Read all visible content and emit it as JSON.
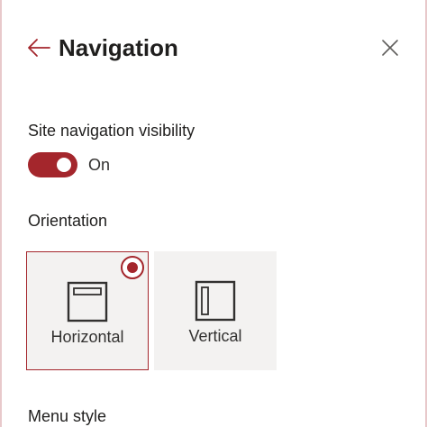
{
  "panel": {
    "title": "Navigation",
    "back_icon": "arrow-left-icon",
    "close_icon": "close-icon"
  },
  "visibility": {
    "label": "Site navigation visibility",
    "toggle_state": "On",
    "enabled": true
  },
  "orientation": {
    "label": "Orientation",
    "options": [
      {
        "label": "Horizontal",
        "selected": true,
        "icon": "horizontal-layout-icon"
      },
      {
        "label": "Vertical",
        "selected": false,
        "icon": "vertical-layout-icon"
      }
    ]
  },
  "menu_style": {
    "label": "Menu style"
  },
  "colors": {
    "accent": "#a4262c",
    "option_bg": "#f3f2f1",
    "text": "#201f1e"
  }
}
